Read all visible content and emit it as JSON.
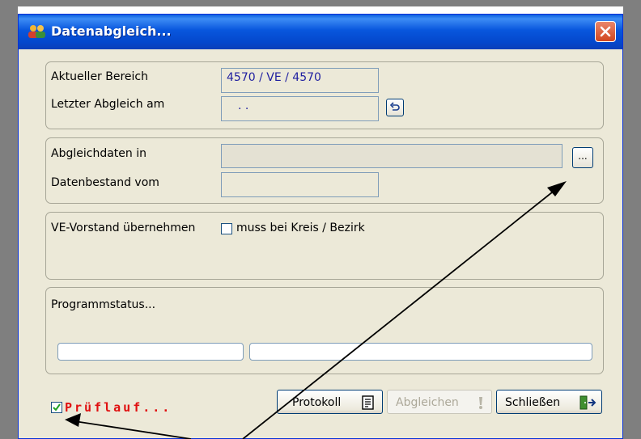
{
  "window": {
    "title": "Datenabgleich..."
  },
  "bereich": {
    "aktueller_label": "Aktueller Bereich",
    "aktueller_value": "4570 / VE / 4570",
    "letzter_label": "Letzter Abgleich am",
    "letzter_value": ". ."
  },
  "daten": {
    "abgleich_label": "Abgleichdaten in",
    "abgleich_value": "",
    "browse_label": "...",
    "bestand_label": "Datenbestand vom",
    "bestand_value": ""
  },
  "vorstand": {
    "label": "VE-Vorstand übernehmen",
    "checkbox_label": "muss bei Kreis / Bezirk",
    "checked": false
  },
  "status": {
    "label": "Programmstatus..."
  },
  "footer": {
    "pruef_label": "Prüflauf...",
    "pruef_checked": true,
    "protokoll_label": "Protokoll",
    "abgleichen_label": "Abgleichen",
    "schliessen_label": "Schließen"
  },
  "colors": {
    "titlebar": "#0856dd",
    "pruef_text": "#e01010",
    "value_text": "#1f1fa0"
  }
}
